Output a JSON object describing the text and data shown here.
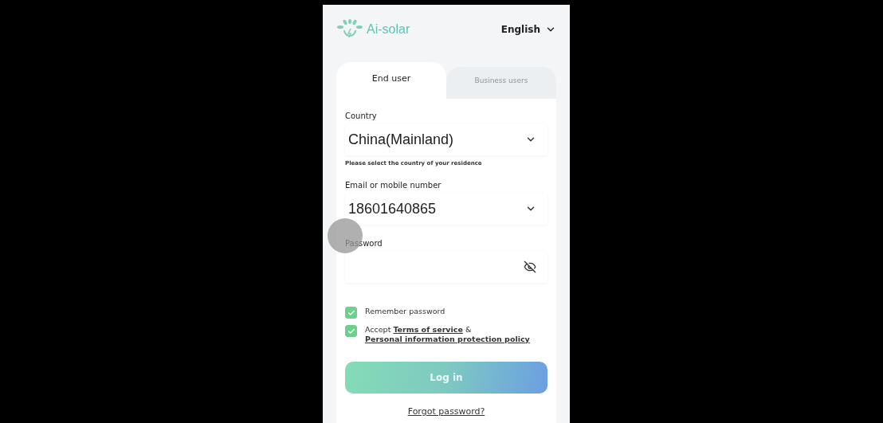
{
  "header": {
    "logo": "Ai-solar",
    "language": "English"
  },
  "tabs": [
    {
      "label": "End user",
      "selected": true
    },
    {
      "label": "Business users",
      "selected": false
    }
  ],
  "fields": [
    {
      "kind": "select",
      "label": "Country",
      "value": "China(Mainland)",
      "hint": "Please select the country of your residence"
    },
    {
      "kind": "select",
      "label": "Email or mobile number",
      "value": "18601640865"
    },
    {
      "kind": "password",
      "label": "Password"
    }
  ],
  "options": [
    {
      "checked": true,
      "segments": [
        {
          "text": "Remember password",
          "link": false
        }
      ]
    },
    {
      "checked": true,
      "segments": [
        {
          "text": "Accept ",
          "link": false
        },
        {
          "text": "Terms of service",
          "link": true
        },
        {
          "text": " & ",
          "link": false
        },
        {
          "text": "Personal information protection policy",
          "link": true
        }
      ]
    }
  ],
  "login_button": "Log in",
  "forgot_link": "Forgot password?"
}
